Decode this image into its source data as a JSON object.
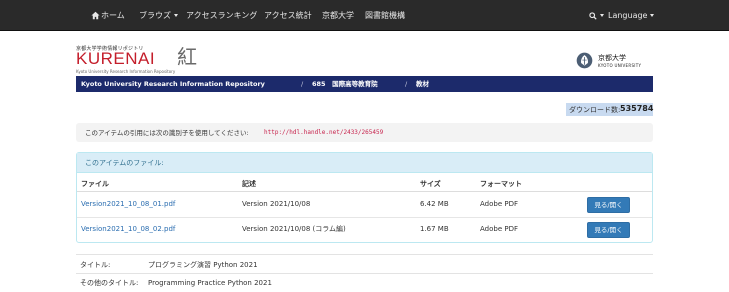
{
  "nav": {
    "home": "ホーム",
    "browse": "ブラウズ",
    "ranking": "アクセスランキング",
    "stats": "アクセス統計",
    "kyoto_univ": "京都大学",
    "library": "図書館機構",
    "language": "Language"
  },
  "header": {
    "logo_top": "京都大学学術情報リポジトリ",
    "logo_text": "KURENAI",
    "logo_kanji": "紅",
    "logo_sub": "Kyoto University Research Information Repository",
    "univ_name": "京都大学",
    "univ_name_en": "KYOTO UNIVERSITY"
  },
  "breadcrumb": {
    "repo": "Kyoto University Research Information Repository",
    "item2": "685　国際高等教育院",
    "item3": "教材"
  },
  "download": {
    "label": "ダウンロード数:",
    "value": "535784"
  },
  "cite": {
    "text": "このアイテムの引用には次の識別子を使用してください:",
    "url": "http://hdl.handle.net/2433/265459"
  },
  "files": {
    "title": "このアイテムのファイル:",
    "headers": {
      "file": "ファイル",
      "desc": "記述",
      "size": "サイズ",
      "format": "フォーマット"
    },
    "rows": [
      {
        "file": "Version2021_10_08_01.pdf",
        "desc": "Version 2021/10/08",
        "size": "6.42 MB",
        "format": "Adobe PDF",
        "button": "見る/開く"
      },
      {
        "file": "Version2021_10_08_02.pdf",
        "desc": "Version 2021/10/08 (コラム編)",
        "size": "1.67 MB",
        "format": "Adobe PDF",
        "button": "見る/開く"
      }
    ]
  },
  "meta": {
    "title_label": "タイトル:",
    "title_value": "プログラミング演習 Python 2021",
    "alt_label": "その他のタイトル:",
    "alt_value": "Programming Practice Python 2021"
  },
  "icons": {
    "home": "home-icon",
    "search": "search-icon",
    "emblem": "university-emblem-icon"
  },
  "colors": {
    "navbar": "#2a2a2a",
    "brand_red": "#c41e2b",
    "breadcrumb_bg": "#1c2a6b",
    "panel_head": "#d9edf7",
    "button": "#337ab7",
    "link": "#2a6db0"
  }
}
